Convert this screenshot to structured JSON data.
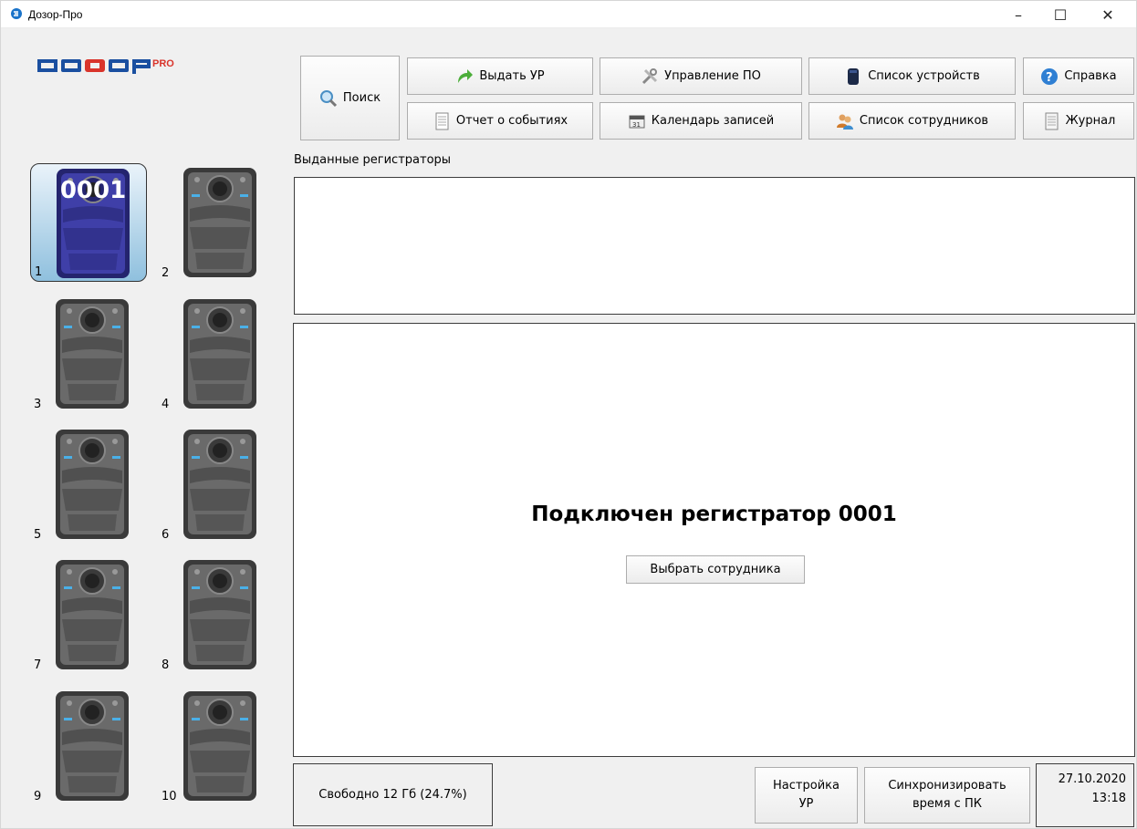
{
  "window": {
    "title": "Дозор-Про",
    "minimize": "–",
    "maximize": "☐",
    "close": "✕"
  },
  "logo": {
    "text": "DOZOR",
    "suffix": "PRO"
  },
  "toolbar": {
    "search": "Поиск",
    "issue": "Выдать УР",
    "software": "Управление ПО",
    "devices": "Список устройств",
    "help": "Справка",
    "events_report": "Отчет о событиях",
    "calendar": "Календарь записей",
    "employees": "Список сотрудников",
    "journal": "Журнал"
  },
  "issued": {
    "label": "Выданные регистраторы"
  },
  "main": {
    "connected": "Подключен регистратор 0001",
    "choose_button": "Выбрать сотрудника"
  },
  "slots": [
    {
      "number": "1",
      "device": "0001",
      "active": true
    },
    {
      "number": "2"
    },
    {
      "number": "3"
    },
    {
      "number": "4"
    },
    {
      "number": "5"
    },
    {
      "number": "6"
    },
    {
      "number": "7"
    },
    {
      "number": "8"
    },
    {
      "number": "9"
    },
    {
      "number": "10"
    }
  ],
  "status": {
    "free_space": "Свободно 12 Гб (24.7%)",
    "settings_line1": "Настройка",
    "settings_line2": "УР",
    "sync_line1": "Синхронизировать",
    "sync_line2": "время с ПК",
    "date": "27.10.2020",
    "time": "13:18"
  },
  "colors": {
    "active_device": "#3f3fa8",
    "device": "#5a5a5a",
    "logo_blue": "#1a4fa0",
    "logo_red": "#d9342b"
  },
  "icons": {
    "search": "magnifier-icon",
    "issue": "green-arrow-icon",
    "software": "tools-icon",
    "devices": "device-list-icon",
    "help": "help-icon",
    "events_report": "document-icon",
    "calendar": "calendar-icon",
    "employees": "users-icon",
    "journal": "journal-icon"
  }
}
